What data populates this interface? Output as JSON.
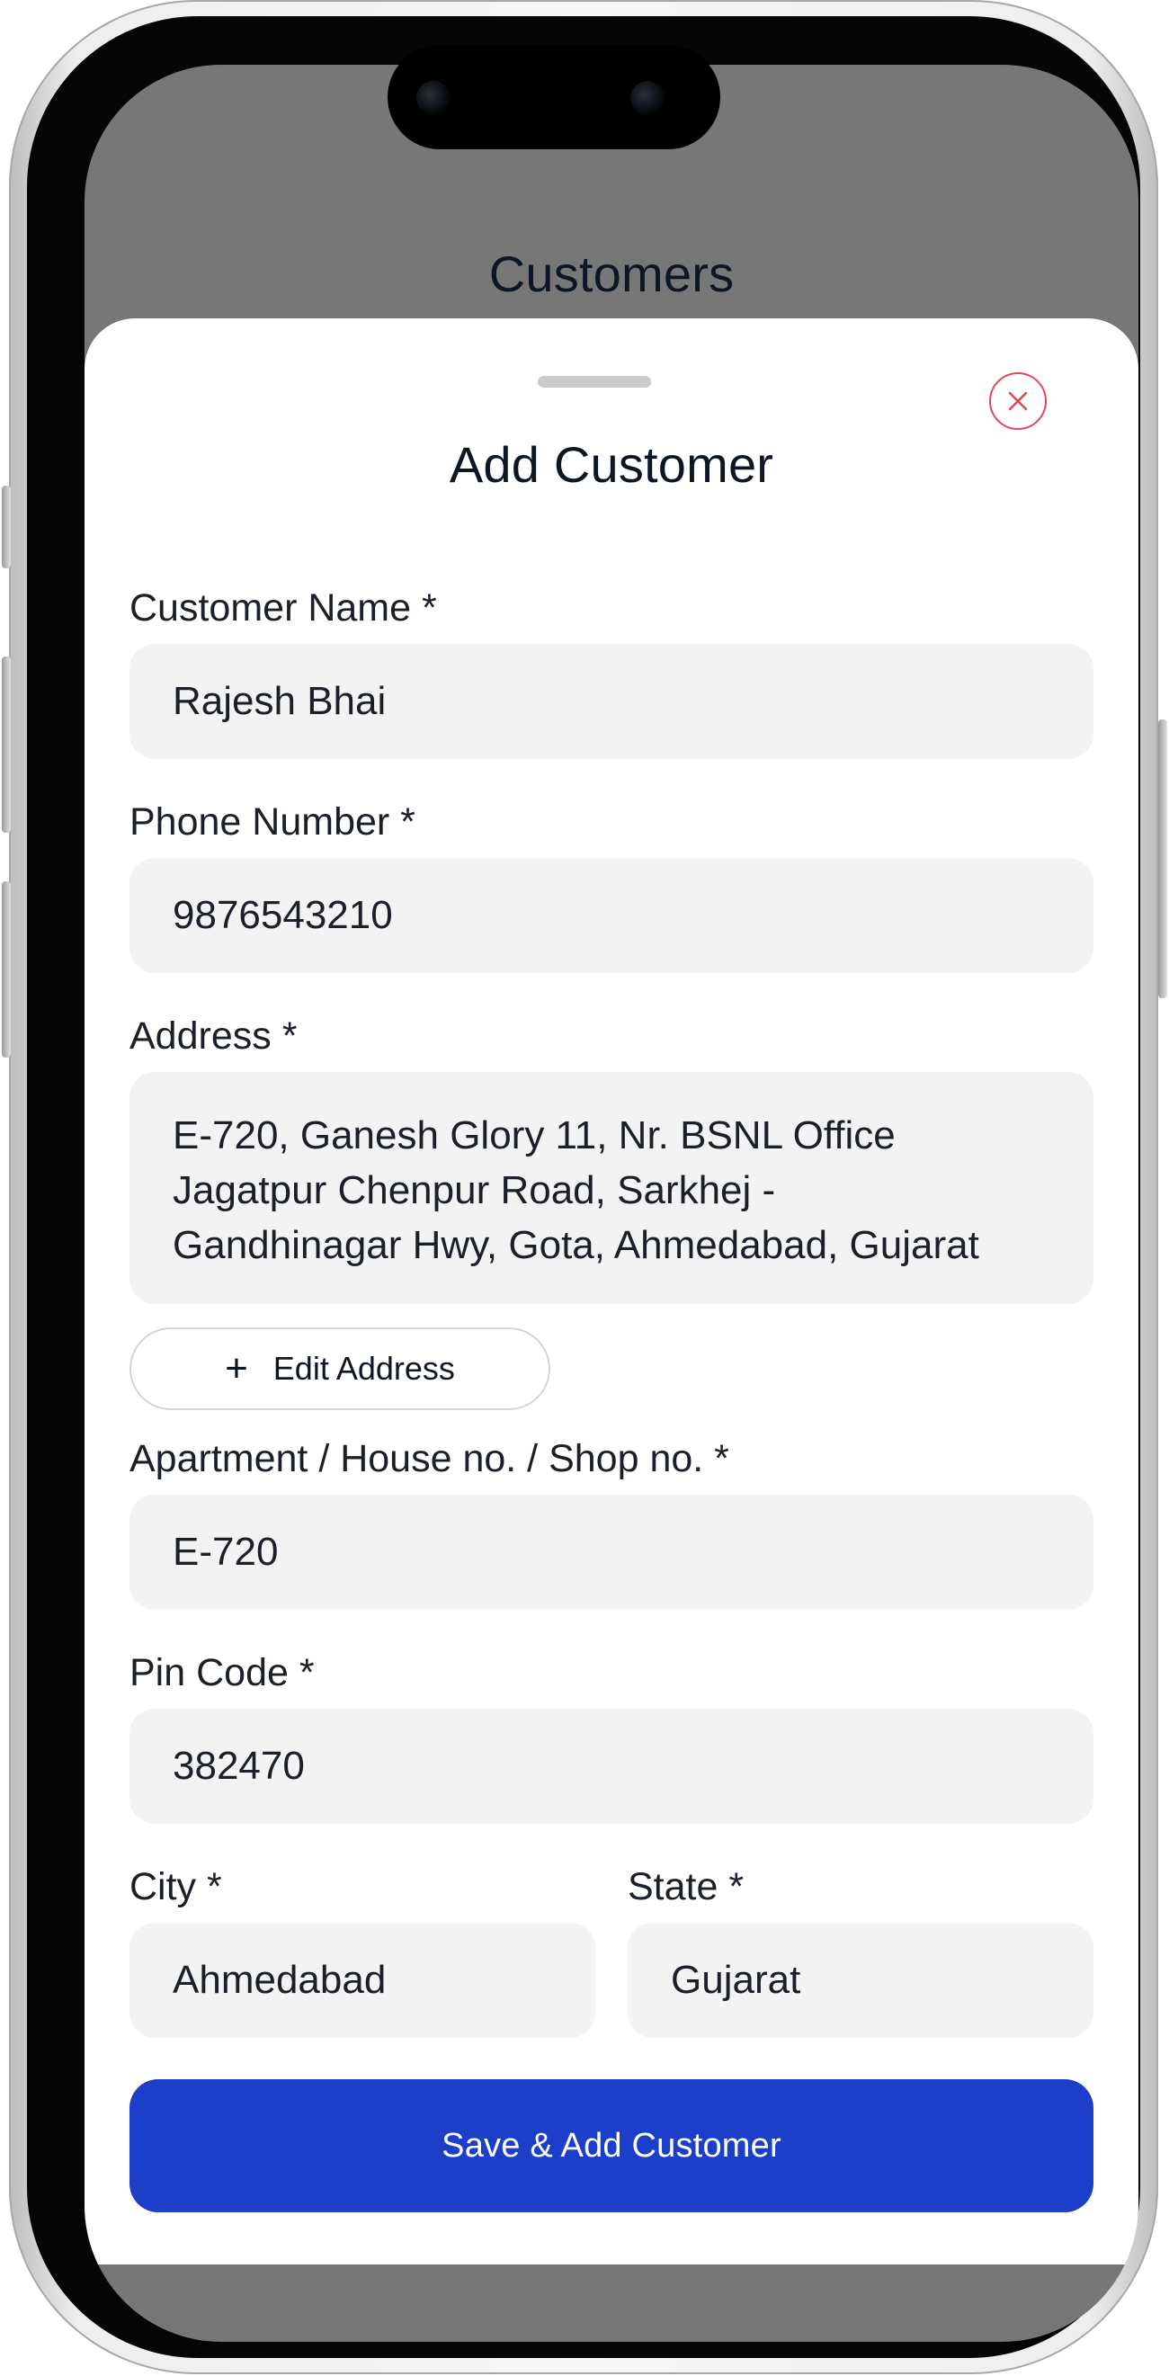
{
  "page": {
    "title": "Customers"
  },
  "sheet": {
    "title": "Add Customer",
    "close_icon": "close-icon",
    "accent_color": "#1c3fc9",
    "close_color": "#de4a54"
  },
  "form": {
    "name": {
      "label": "Customer Name *",
      "value": "Rajesh Bhai"
    },
    "phone": {
      "label": "Phone Number *",
      "value": "9876543210"
    },
    "address": {
      "label": "Address *",
      "lines": [
        "E-720, Ganesh Glory 11, Nr. BSNL Office",
        "Jagatpur Chenpur Road, Sarkhej -",
        "Gandhinagar Hwy, Gota, Ahmedabad, Gujarat"
      ]
    },
    "edit_address": {
      "icon": "plus-icon",
      "symbol": "+",
      "label": "Edit Address"
    },
    "apartment": {
      "label": "Apartment / House no. / Shop no. *",
      "value": "E-720"
    },
    "pincode": {
      "label": "Pin Code *",
      "value": "382470"
    },
    "city": {
      "label": "City *",
      "value": "Ahmedabad"
    },
    "state": {
      "label": "State *",
      "value": "Gujarat"
    }
  },
  "actions": {
    "save_label": "Save & Add Customer"
  }
}
